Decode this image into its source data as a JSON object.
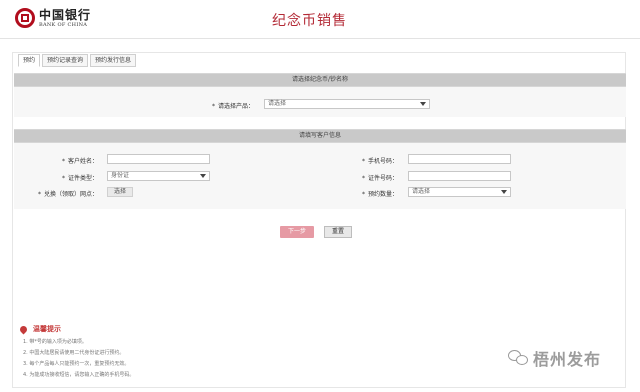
{
  "header": {
    "logo_cn": "中国银行",
    "logo_en": "BANK OF CHINA",
    "page_title": "纪念币销售"
  },
  "tabs": [
    {
      "label": "预约"
    },
    {
      "label": "预约记录查询"
    },
    {
      "label": "预约发行信息"
    }
  ],
  "section1": {
    "title": "请选择纪念币/钞名称",
    "product_label": "请选择产品：",
    "product_select_value": "请选择"
  },
  "section2": {
    "title": "请填写客户信息",
    "customer_name_label": "客户姓名：",
    "id_type_label": "证件类型：",
    "id_type_value": "身份证",
    "outlet_label": "兑换（领取）网点：",
    "outlet_button": "选择",
    "phone_label": "手机号码：",
    "id_number_label": "证件号码：",
    "quantity_label": "预约数量：",
    "quantity_select_value": "请选择"
  },
  "actions": {
    "next_label": "下一步",
    "reset_label": "重置"
  },
  "tips": {
    "title": "温馨提示",
    "lines": [
      "1. 带*号的输入项为必填项。",
      "2. 中国大陆居民请使用二代身份证进行预约。",
      "3. 每个产品每人只能预约一次，重复预约无效。",
      "4. 为能成功接收短信，请您输入正确的手机号码。"
    ]
  },
  "watermark": {
    "text": "梧州发布"
  },
  "colors": {
    "brand_red": "#b10d1d",
    "title_red": "#b32a36",
    "next_button": "#e69aa4",
    "section_bar": "#c9c9c9"
  },
  "required_mark": "*"
}
